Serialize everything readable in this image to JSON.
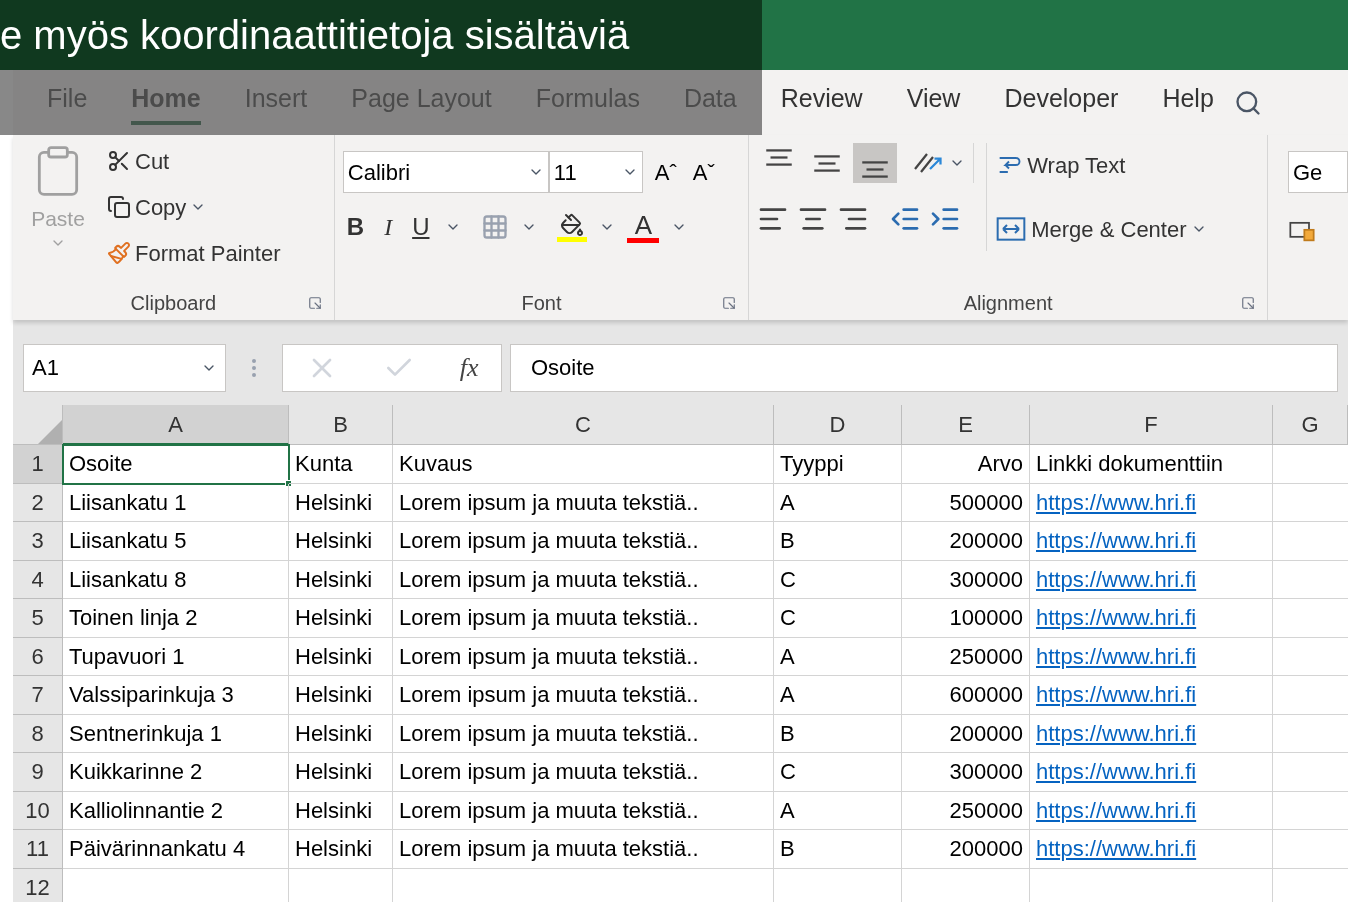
{
  "caption": "e myös koordinaattitietoja sisältäviä",
  "tabs": [
    {
      "label": "File",
      "selected": false
    },
    {
      "label": "Home",
      "selected": true
    },
    {
      "label": "Insert",
      "selected": false
    },
    {
      "label": "Page Layout",
      "selected": false
    },
    {
      "label": "Formulas",
      "selected": false
    },
    {
      "label": "Data",
      "selected": false
    },
    {
      "label": "Review",
      "selected": false
    },
    {
      "label": "View",
      "selected": false
    },
    {
      "label": "Developer",
      "selected": false
    },
    {
      "label": "Help",
      "selected": false
    }
  ],
  "clipboard": {
    "label": "Clipboard",
    "paste": {
      "label": "Paste",
      "disabled": true
    },
    "cut": "Cut",
    "copy": "Copy",
    "format_painter": "Format Painter"
  },
  "font": {
    "label": "Font",
    "family": "Calibri",
    "size": "11",
    "grow": "Aˆ",
    "shrink": "Aˇ",
    "bold": "B",
    "italic": "I",
    "underline": "U",
    "font_color_label": "A"
  },
  "alignment": {
    "label": "Alignment",
    "vertical": [
      {
        "selected": false
      },
      {
        "selected": false
      },
      {
        "selected": true
      }
    ],
    "wrap_text": "Wrap Text",
    "merge": "Merge & Center"
  },
  "number": {
    "format": "Ge"
  },
  "formula_bar": {
    "name_box": "A1",
    "fx": "fx",
    "value": "Osoite"
  },
  "columns": [
    {
      "label": "A",
      "kind": "text",
      "selected": true
    },
    {
      "label": "B",
      "kind": "text",
      "selected": false
    },
    {
      "label": "C",
      "kind": "text",
      "selected": false
    },
    {
      "label": "D",
      "kind": "text",
      "selected": false
    },
    {
      "label": "E",
      "kind": "number",
      "selected": false
    },
    {
      "label": "F",
      "kind": "link",
      "selected": false
    },
    {
      "label": "G",
      "kind": "text",
      "selected": false
    }
  ],
  "rows": [
    {
      "num": "1",
      "selected": true,
      "cells": [
        "Osoite",
        "Kunta",
        "Kuvaus",
        "Tyyppi",
        "Arvo",
        "Linkki dokumenttiin"
      ]
    },
    {
      "num": "2",
      "selected": false,
      "cells": [
        "Liisankatu 1",
        "Helsinki",
        "Lorem ipsum ja muuta tekstiä..",
        "A",
        "500000",
        "https://www.hri.fi"
      ]
    },
    {
      "num": "3",
      "selected": false,
      "cells": [
        "Liisankatu 5",
        "Helsinki",
        "Lorem ipsum ja muuta tekstiä..",
        "B",
        "200000",
        "https://www.hri.fi"
      ]
    },
    {
      "num": "4",
      "selected": false,
      "cells": [
        "Liisankatu 8",
        "Helsinki",
        "Lorem ipsum ja muuta tekstiä..",
        "C",
        "300000",
        "https://www.hri.fi"
      ]
    },
    {
      "num": "5",
      "selected": false,
      "cells": [
        "Toinen linja 2",
        "Helsinki",
        "Lorem ipsum ja muuta tekstiä..",
        "C",
        "100000",
        "https://www.hri.fi"
      ]
    },
    {
      "num": "6",
      "selected": false,
      "cells": [
        "Tupavuori 1",
        "Helsinki",
        "Lorem ipsum ja muuta tekstiä..",
        "A",
        "250000",
        "https://www.hri.fi"
      ]
    },
    {
      "num": "7",
      "selected": false,
      "cells": [
        "Valssiparinkuja 3",
        "Helsinki",
        "Lorem ipsum ja muuta tekstiä..",
        "A",
        "600000",
        "https://www.hri.fi"
      ]
    },
    {
      "num": "8",
      "selected": false,
      "cells": [
        "Sentnerinkuja 1",
        "Helsinki",
        "Lorem ipsum ja muuta tekstiä..",
        "B",
        "200000",
        "https://www.hri.fi"
      ]
    },
    {
      "num": "9",
      "selected": false,
      "cells": [
        "Kuikkarinne 2",
        "Helsinki",
        "Lorem ipsum ja muuta tekstiä..",
        "C",
        "300000",
        "https://www.hri.fi"
      ]
    },
    {
      "num": "10",
      "selected": false,
      "cells": [
        "Kalliolinnantie 2",
        "Helsinki",
        "Lorem ipsum ja muuta tekstiä..",
        "A",
        "250000",
        "https://www.hri.fi"
      ]
    },
    {
      "num": "11",
      "selected": false,
      "cells": [
        "Päivärinnankatu 4",
        "Helsinki",
        "Lorem ipsum ja muuta tekstiä..",
        "B",
        "200000",
        "https://www.hri.fi"
      ]
    },
    {
      "num": "12",
      "selected": false,
      "cells": []
    }
  ]
}
